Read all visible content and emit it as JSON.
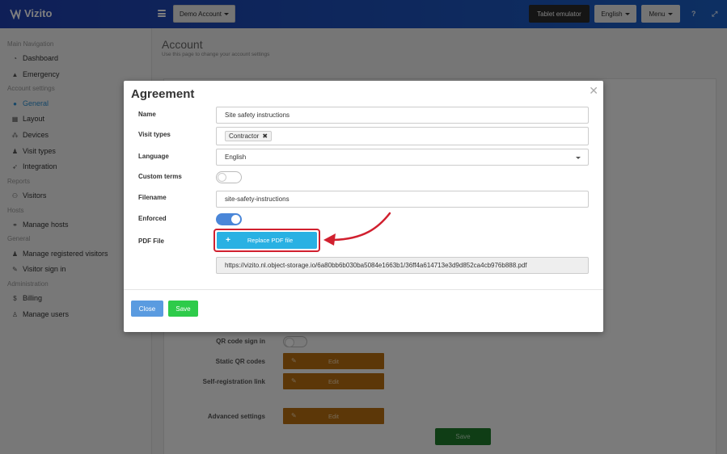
{
  "app": {
    "name": "Vizito"
  },
  "topbar": {
    "account_selector": "Demo Account",
    "tablet_emulator": "Tablet emulator",
    "language": "English",
    "menu": "Menu",
    "help_icon": "question-icon",
    "expand_icon": "expand-icon"
  },
  "sidebar": {
    "sections": [
      {
        "heading": "Main Navigation",
        "items": [
          {
            "label": "Dashboard",
            "icon": "dashboard-icon"
          },
          {
            "label": "Emergency",
            "icon": "warning-icon"
          }
        ]
      },
      {
        "heading": "Account settings",
        "items": [
          {
            "label": "General",
            "icon": "gear-icon",
            "active": true
          },
          {
            "label": "Layout",
            "icon": "layout-icon"
          },
          {
            "label": "Devices",
            "icon": "devices-icon"
          },
          {
            "label": "Visit types",
            "icon": "users-icon"
          },
          {
            "label": "Integration",
            "icon": "rocket-icon"
          }
        ]
      },
      {
        "heading": "Reports",
        "items": [
          {
            "label": "Visitors",
            "icon": "visitors-icon"
          }
        ]
      },
      {
        "heading": "Hosts",
        "items": [
          {
            "label": "Manage hosts",
            "icon": "link-icon"
          }
        ]
      },
      {
        "heading": "General",
        "items": [
          {
            "label": "Manage registered visitors",
            "icon": "users-icon"
          },
          {
            "label": "Visitor sign in",
            "icon": "pencil-icon"
          }
        ]
      },
      {
        "heading": "Administration",
        "items": [
          {
            "label": "Billing",
            "icon": "dollar-icon"
          },
          {
            "label": "Manage users",
            "icon": "user-plus-icon"
          }
        ]
      }
    ]
  },
  "page": {
    "title": "Account",
    "subtitle": "Use this page to change your account settings",
    "background_fields": [
      {
        "label": "QR code sign in"
      },
      {
        "label": "Static QR codes",
        "button": "Edit"
      },
      {
        "label": "Self-registration link",
        "button": "Edit"
      },
      {
        "label": "Advanced settings",
        "button": "Edit"
      }
    ],
    "save_label": "Save"
  },
  "modal": {
    "title": "Agreement",
    "fields": {
      "name": {
        "label": "Name",
        "value": "Site safety instructions"
      },
      "visit_types": {
        "label": "Visit types",
        "tag": "Contractor"
      },
      "language": {
        "label": "Language",
        "value": "English"
      },
      "custom_terms": {
        "label": "Custom terms",
        "on": false
      },
      "filename": {
        "label": "Filename",
        "value": "site-safety-instructions"
      },
      "enforced": {
        "label": "Enforced",
        "on": true
      },
      "pdf_file": {
        "label": "PDF File",
        "button": "Replace PDF file",
        "url": "https://vizito.nl.object-storage.io/6a80bb6b030ba5084e1663b1/36ff4a614713e3d9d852ca4cb976b888.pdf"
      }
    },
    "close_label": "Close",
    "save_label": "Save"
  },
  "colors": {
    "topbar": "#1f3fae",
    "accent": "#29b1e3",
    "highlight": "#d1202f",
    "save_green": "#2ecb4a",
    "close_blue": "#5a9be0",
    "toggle_on": "#4a86d8"
  }
}
